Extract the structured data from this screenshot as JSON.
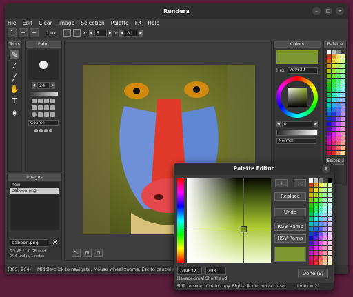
{
  "window": {
    "title": "Rendera"
  },
  "menu": [
    "File",
    "Edit",
    "Clear",
    "Image",
    "Selection",
    "Palette",
    "FX",
    "Help"
  ],
  "toolbar": {
    "zoom_level": "1",
    "zoom_in": "+",
    "zoom_out": "−",
    "aspect": "1.0x",
    "x_label": "X:",
    "x_value": "8",
    "y_label": "Y:",
    "y_value": "8"
  },
  "tools": {
    "title": "Tools"
  },
  "paint": {
    "title": "Paint",
    "brush_size": "24",
    "shape_select": "Coarse"
  },
  "images": {
    "title": "Images",
    "list": [
      "new",
      "baboon.png"
    ],
    "filename": "baboon.png",
    "memory": "6.3 MB / 1.0 GB used",
    "undo": "0/16 undos, 1 redos"
  },
  "colors": {
    "title": "Colors",
    "hex_label": "Hex:",
    "hex_value": "7d9632",
    "alpha_value": "0",
    "blend_mode": "Normal",
    "swatch_color": "#7d9632"
  },
  "palette": {
    "title": "Palette",
    "editor_button": "Editor..."
  },
  "status": {
    "coords": "(305, 264)",
    "message": "Middle-click to navigate. Mouse wheel zooms. Esc to cancel rendering."
  },
  "palette_editor": {
    "title": "Palette Editor",
    "plus": "+",
    "minus": "-",
    "replace": "Replace",
    "undo": "Undo",
    "rgb_ramp": "RGB Ramp",
    "hsv_ramp": "HSV Ramp",
    "hex_value": "7d9632",
    "hex_label": "Hexadecimal",
    "shorthand_value": "793",
    "shorthand_label": "Shorthand",
    "done": "Done (E)",
    "hint": "Shift to swap. Ctrl to copy. Right-click to move cursor.",
    "index": "Index = 21"
  }
}
